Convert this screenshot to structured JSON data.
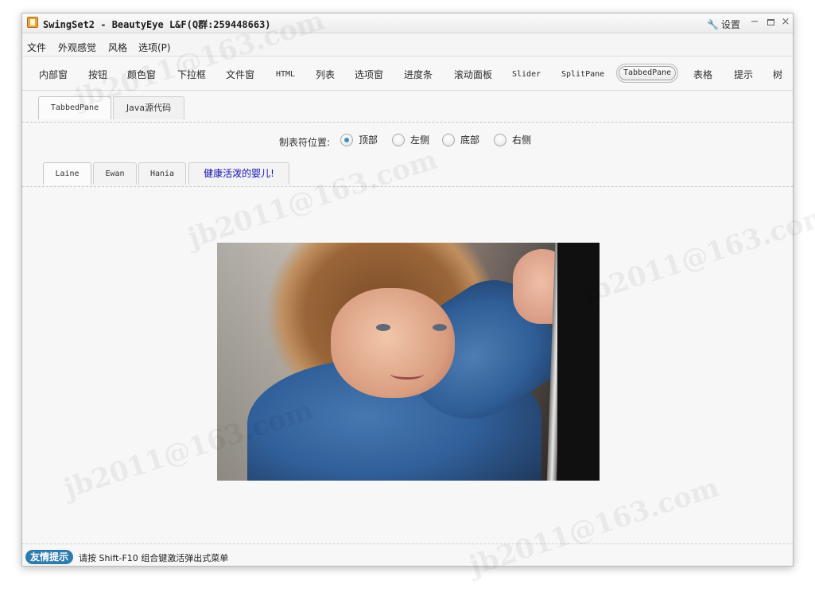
{
  "window": {
    "title": "SwingSet2 - BeautyEye L&F(Q群:259448663)",
    "settings_label": "设置",
    "icons": {
      "app": "application-icon",
      "settings": "wrench-icon",
      "minimize": "minimize-icon",
      "maximize": "maximize-icon",
      "close": "close-icon"
    }
  },
  "menu": {
    "file": "文件",
    "look_and_feel": "外观感觉",
    "style": "风格",
    "options": "选项(P)"
  },
  "toolbar": {
    "internal_frame": "内部窗",
    "button": "按钮",
    "color_chooser": "颜色窗",
    "combo_box": "下拉框",
    "file_chooser": "文件窗",
    "html": "HTML",
    "list": "列表",
    "option_pane": "选项窗",
    "progress_bar": "进度条",
    "scroll_pane": "滚动面板",
    "slider": "Slider",
    "split_pane": "SplitPane",
    "tabbed_pane": "TabbedPane",
    "table": "表格",
    "tooltip": "提示",
    "tree": "树"
  },
  "demo_tabs": {
    "tabbed_pane": "TabbedPane",
    "java_source": "Java源代码"
  },
  "placement": {
    "label": "制表符位置:",
    "top": "顶部",
    "left": "左侧",
    "bottom": "底部",
    "right": "右侧",
    "selected": "顶部"
  },
  "child_tabs": {
    "laine": "Laine",
    "ewan": "Ewan",
    "hania": "Hania",
    "baby": "健康活泼的婴儿!"
  },
  "status": {
    "badge": "友情提示",
    "message": "请按 Shift-F10 组合键激活弹出式菜单"
  },
  "watermark": {
    "text": "jb2011@163.com"
  },
  "colors": {
    "accent": "#2e7cae",
    "selected_radio": "#3f8dc7",
    "link_tab": "#1010b0"
  }
}
